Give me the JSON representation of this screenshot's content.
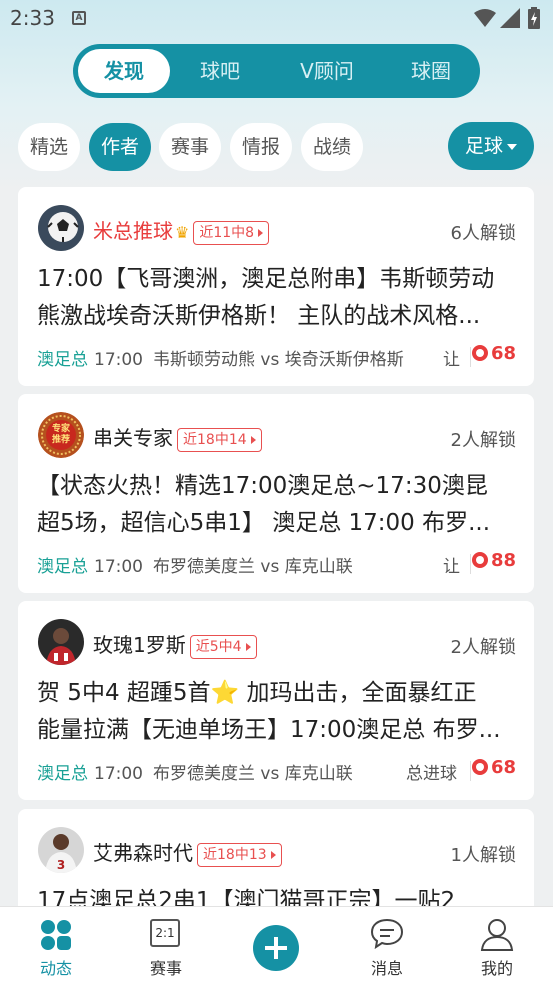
{
  "status": {
    "time": "2:33",
    "a_label": "A"
  },
  "nav": {
    "tabs": [
      {
        "label": "发现",
        "active": true
      },
      {
        "label": "球吧"
      },
      {
        "label": "V顾问"
      },
      {
        "label": "球圈"
      }
    ]
  },
  "filters": {
    "chips": [
      {
        "label": "精选"
      },
      {
        "label": "作者",
        "active": true
      },
      {
        "label": "赛事"
      },
      {
        "label": "情报"
      },
      {
        "label": "战绩"
      }
    ],
    "sport_label": "足球"
  },
  "posts": [
    {
      "author": "米总推球",
      "crown": true,
      "record": "近11中8",
      "unlocks": "6人解锁",
      "title_lines": [
        "17:00【飞哥澳洲，澳足总附串】韦斯顿劳动",
        "熊激战埃奇沃斯伊格斯！ 主队的战术风格..."
      ],
      "league": "澳足总",
      "time": "17:00",
      "match": "韦斯顿劳动熊 vs 埃奇沃斯伊格斯",
      "play_type": "让",
      "score": "68",
      "avatar": "soccer-ball-avatar"
    },
    {
      "author": "串关专家",
      "record": "近18中14",
      "unlocks": "2人解锁",
      "title_lines": [
        "【状态火热！精选17:00澳足总~17:30澳昆",
        "超5场，超信心5串1】 澳足总 17:00 布罗..."
      ],
      "league": "澳足总",
      "time": "17:00",
      "match": "布罗德美度兰 vs 库克山联",
      "play_type": "让",
      "score": "88",
      "avatar": "expert-badge-avatar",
      "badge_text": [
        "专家",
        "推荐"
      ]
    },
    {
      "author": "玫瑰1罗斯",
      "record": "近5中4",
      "unlocks": "2人解锁",
      "title_lines": [
        "贺 5中4 超踵5首⭐ 加玛出击，全面暴红正",
        "能量拉满【无迪单场王】17:00澳足总 布罗..."
      ],
      "league": "澳足总",
      "time": "17:00",
      "match": "布罗德美度兰 vs 库克山联",
      "play_type": "总进球",
      "score": "68",
      "avatar": "player-avatar"
    },
    {
      "author": "艾弗森时代",
      "record": "近18中13",
      "unlocks": "1人解锁",
      "title_lines": [
        "17点澳足总2串1【澳门猫哥正宗】一贴2"
      ],
      "avatar": "player-3-avatar"
    }
  ],
  "bottom_nav": {
    "items": [
      {
        "label": "动态",
        "icon": "feed-icon",
        "active": true
      },
      {
        "label": "赛事",
        "icon": "scoreboard-icon"
      },
      {
        "label": "",
        "icon": "plus-icon"
      },
      {
        "label": "消息",
        "icon": "message-icon"
      },
      {
        "label": "我的",
        "icon": "profile-icon"
      }
    ],
    "scoreboard_text": "2:1"
  },
  "colors": {
    "accent": "#1591a4",
    "hot": "#e83c3c",
    "league": "#1aa196"
  }
}
